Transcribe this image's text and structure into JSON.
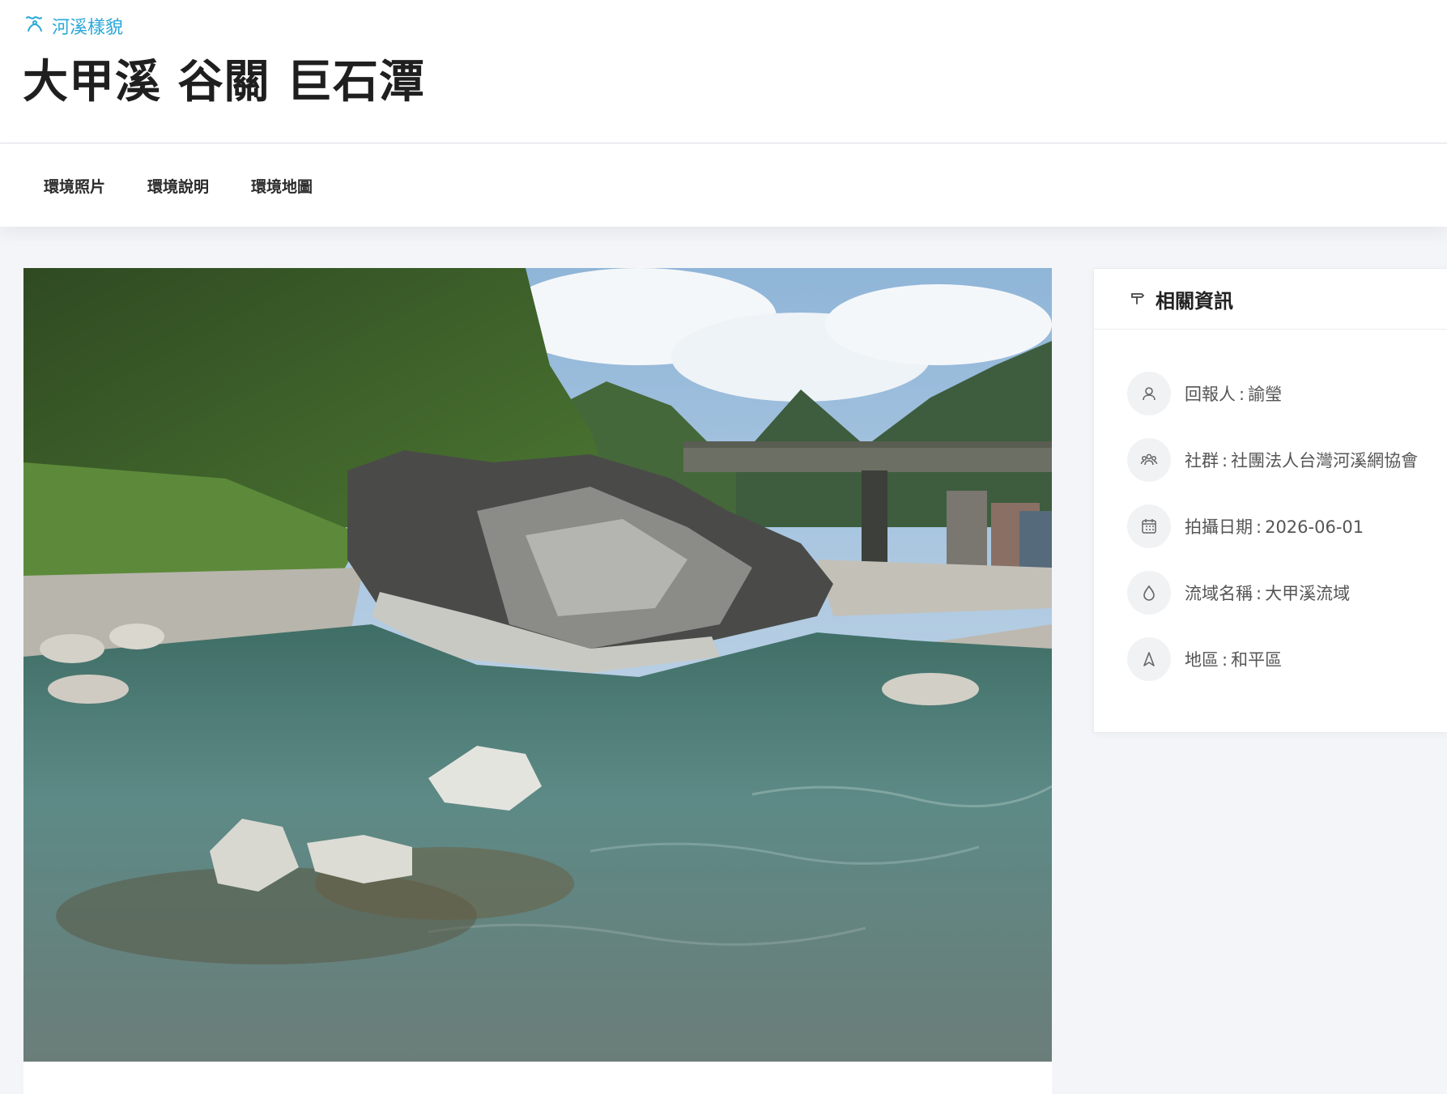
{
  "breadcrumb": {
    "icon": "river-icon",
    "label": "河溪樣貌"
  },
  "page_title": "大甲溪 谷關 巨石潭",
  "tabs": [
    {
      "label": "環境照片"
    },
    {
      "label": "環境說明"
    },
    {
      "label": "環境地圖"
    }
  ],
  "photo": {
    "description_icon": "photo"
  },
  "info": {
    "title": "相關資訊",
    "title_icon": "signpost-icon",
    "rows": [
      {
        "icon": "person-icon",
        "label": "回報人",
        "value": "諭瑩"
      },
      {
        "icon": "group-icon",
        "label": "社群",
        "value": "社團法人台灣河溪網協會"
      },
      {
        "icon": "calendar-icon",
        "label": "拍攝日期",
        "value": "2026-06-01"
      },
      {
        "icon": "water-drop-icon",
        "label": "流域名稱",
        "value": "大甲溪流域"
      },
      {
        "icon": "location-arrow-icon",
        "label": "地區",
        "value": "和平區"
      }
    ]
  },
  "colors": {
    "accent": "#2aa8d8",
    "background": "#f3f5f8",
    "text": "#222222",
    "muted": "#555555"
  }
}
